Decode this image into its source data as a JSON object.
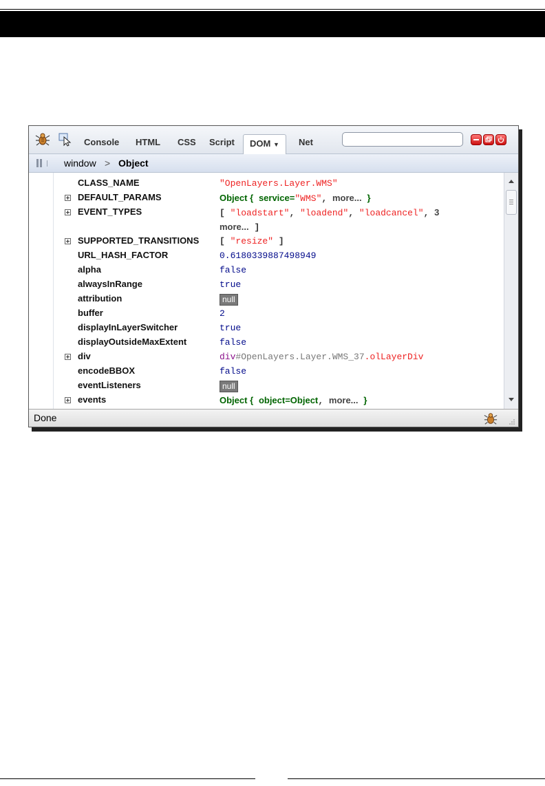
{
  "toolbar": {
    "tabs": [
      "Console",
      "HTML",
      "CSS",
      "Script",
      "DOM",
      "Net"
    ],
    "active_tab": "DOM",
    "search_value": ""
  },
  "breadcrumb": {
    "root": "window",
    "separator": ">",
    "current": "Object"
  },
  "status": {
    "text": "Done"
  },
  "colors": {
    "string": "#e22222",
    "number": "#00098a",
    "object": "#006400",
    "null_bg": "#7a7a7a"
  },
  "properties": [
    {
      "name": "CLASS_NAME",
      "expandable": false,
      "value": "\"OpenLayers.Layer.WMS\""
    },
    {
      "name": "DEFAULT_PARAMS",
      "expandable": true,
      "obj": "Object {",
      "key": "service=",
      "str": "\"WMS\"",
      "sep": ",",
      "more": "more...",
      "close": "}"
    },
    {
      "name": "EVENT_TYPES",
      "expandable": true,
      "open": "[",
      "items": [
        "\"loadstart\"",
        "\"loadend\"",
        "\"loadcancel\""
      ],
      "count": "3",
      "more": "more...",
      "close": "]"
    },
    {
      "name": "SUPPORTED_TRANSITIONS",
      "expandable": true,
      "open": "[",
      "str": "\"resize\"",
      "close": "]"
    },
    {
      "name": "URL_HASH_FACTOR",
      "expandable": false,
      "value": "0.6180339887498949"
    },
    {
      "name": "alpha",
      "expandable": false,
      "value": "false"
    },
    {
      "name": "alwaysInRange",
      "expandable": false,
      "value": "true"
    },
    {
      "name": "attribution",
      "expandable": false,
      "value": "null"
    },
    {
      "name": "buffer",
      "expandable": false,
      "value": "2"
    },
    {
      "name": "displayInLayerSwitcher",
      "expandable": false,
      "value": "true"
    },
    {
      "name": "displayOutsideMaxExtent",
      "expandable": false,
      "value": "false"
    },
    {
      "name": "div",
      "expandable": true,
      "tag": "div",
      "value": "#OpenLayers.Layer.WMS_37",
      "cls": ".olLayerDiv"
    },
    {
      "name": "encodeBBOX",
      "expandable": false,
      "value": "false"
    },
    {
      "name": "eventListeners",
      "expandable": false,
      "value": "null"
    },
    {
      "name": "events",
      "expandable": true,
      "obj": "Object {",
      "key": "object=Object",
      "sep": ",",
      "more": "more...",
      "close": "}"
    }
  ]
}
